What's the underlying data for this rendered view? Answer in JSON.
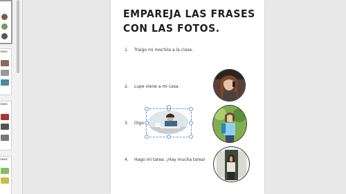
{
  "thumbnails": [
    {
      "title": "",
      "selected": true
    },
    {
      "title": "rases",
      "selected": false
    },
    {
      "title": "rases",
      "selected": false
    },
    {
      "title": "rases",
      "selected": false
    }
  ],
  "slide": {
    "title_line1": "EMPAREJA LAS FRASES",
    "title_line2": "CON LAS FOTOS.",
    "items": [
      {
        "number": "1.",
        "text": "Traigo mi mochila a la clase."
      },
      {
        "number": "2.",
        "text": "Lupe viene a mi casa."
      },
      {
        "number": "3.",
        "text": "Oigo un"
      },
      {
        "number": "4.",
        "text": "Hago mi tarea. ¡Hay mucha tarea!"
      }
    ],
    "photos": [
      {
        "name": "girl-on-phone-photo"
      },
      {
        "name": "girl-with-backpack-photo"
      },
      {
        "name": "woman-in-doorway-photo"
      },
      {
        "name": "boy-at-desk-photo"
      }
    ]
  }
}
